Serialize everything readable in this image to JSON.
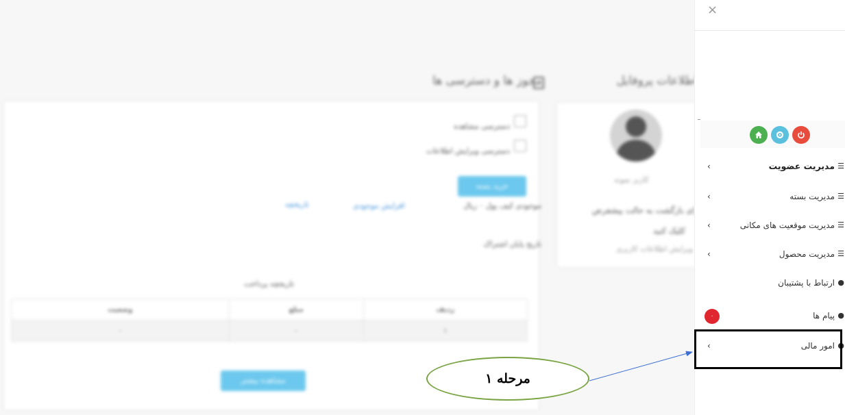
{
  "background": {
    "profile_title": "اطلاعات پروفایل",
    "permissions_title": "مجوز ها و دسترسی ها",
    "profile_name": "کاربر نمونه",
    "profile_desc_1": "برای بازگشت به حالت پیشفرض",
    "profile_desc_2": "کلیک کنید",
    "profile_link": "ویرایش اطلاعات کاربری",
    "perm_check_1": "دسترسی مشاهده",
    "perm_check_2": "دسترسی ویرایش اطلاعات",
    "perm_button": "خرید بسته",
    "credit_text": "موجودی کیف پول ۰ ریال",
    "credit_link_1": "افزایش موجودی",
    "credit_link_2": "تاریخچه",
    "expiry_text": "تاریخ پایان اشتراک",
    "table_title": "تاریخچه پرداخت",
    "table_headers": [
      "ردیف",
      "مبلغ",
      "وضعیت"
    ],
    "table_row": [
      "۱",
      "-",
      "-"
    ],
    "bottom_button": "مشاهده بیشتر"
  },
  "sidebar": {
    "close_label": "×",
    "icon_buttons": [
      {
        "name": "home",
        "color": "#4caf50"
      },
      {
        "name": "settings",
        "color": "#5bc0de"
      },
      {
        "name": "power",
        "color": "#e74c3c"
      }
    ],
    "items": [
      {
        "label": "مدیریت عضویت",
        "icon": "list",
        "has_chevron": true,
        "bold": true
      },
      {
        "label": "مدیریت بسته",
        "icon": "list",
        "has_chevron": true,
        "bold": false
      },
      {
        "label": "مدیریت موقعیت های مکانی",
        "icon": "list",
        "has_chevron": true,
        "bold": false
      },
      {
        "label": "مدیریت محصول",
        "icon": "list",
        "has_chevron": true,
        "bold": false
      },
      {
        "label": "ارتباط با پشتیبان",
        "icon": "comment",
        "has_chevron": false,
        "bold": false
      },
      {
        "label": "پیام ها",
        "icon": "comment",
        "has_chevron": false,
        "bold": false
      },
      {
        "label": "امور مالی",
        "icon": "user",
        "has_chevron": true,
        "bold": false
      }
    ],
    "messages_badge": "۰"
  },
  "annotation": {
    "step_label": "مرحله ۱"
  },
  "colors": {
    "highlight_border": "#000000",
    "callout_border": "#79a343",
    "arrow": "#3b6fd4",
    "badge": "#e0262f"
  }
}
